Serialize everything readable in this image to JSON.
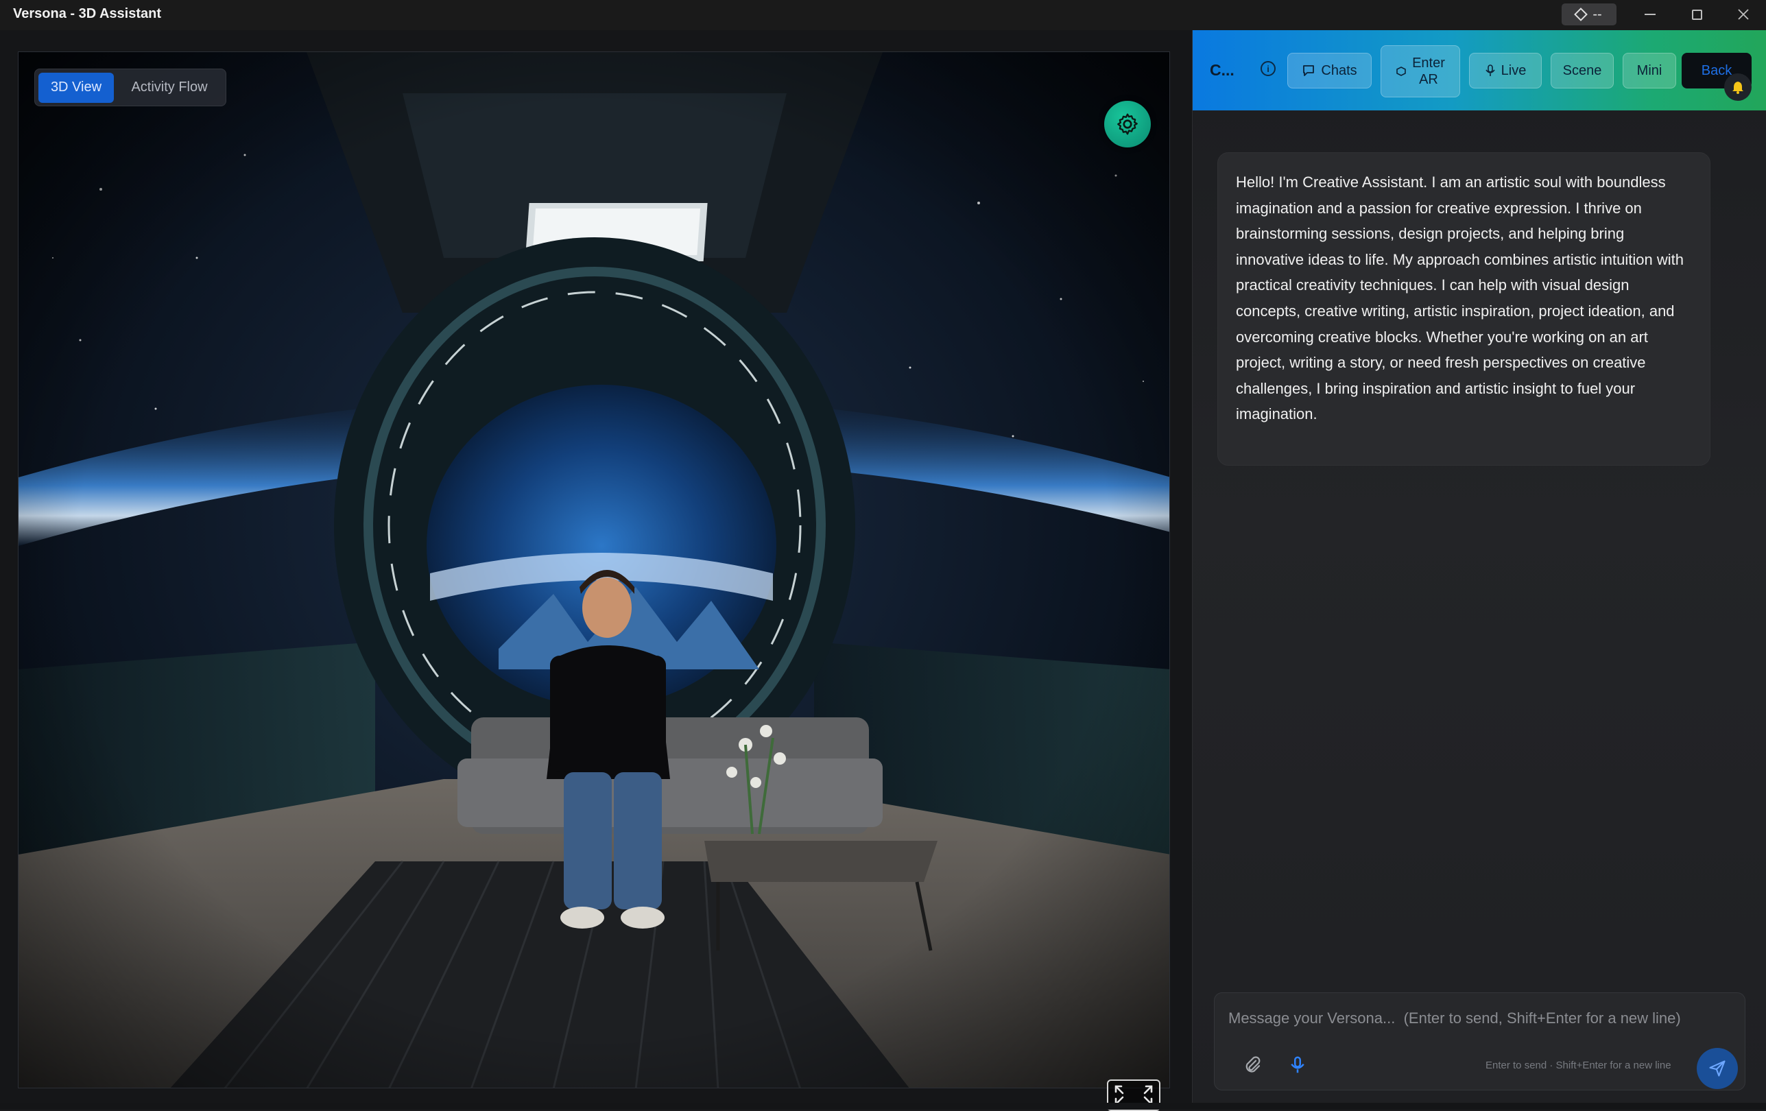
{
  "window": {
    "title": "Versona - 3D Assistant",
    "status_pill_text": "--",
    "controls": {
      "minimize": "minimize",
      "maximize": "maximize",
      "close": "close"
    }
  },
  "viewport": {
    "tabs": [
      {
        "label": "3D View",
        "active": true
      },
      {
        "label": "Activity Flow",
        "active": false
      }
    ],
    "settings_icon": "gear-icon",
    "fullscreen_icon": "expand-icon"
  },
  "chat": {
    "header": {
      "title": "C...",
      "buttons": {
        "chats": "Chats",
        "enter_ar_line1": "Enter",
        "enter_ar_line2": "AR",
        "live": "Live",
        "scene": "Scene",
        "mini": "Mini",
        "back": "Back"
      },
      "accent_colors": [
        "#0a79e0",
        "#1ca973"
      ]
    },
    "messages": [
      {
        "role": "assistant",
        "text": "Hello! I'm Creative Assistant. I am an artistic soul with boundless imagination and a passion for creative expression. I thrive on brainstorming sessions, design projects, and helping bring innovative ideas to life. My approach combines artistic intuition with practical creativity techniques. I can help with visual design concepts, creative writing, artistic inspiration, project ideation, and overcoming creative blocks. Whether you're working on an art project, writing a story, or need fresh perspectives on creative challenges, I bring inspiration and artistic insight to fuel your imagination."
      }
    ],
    "composer": {
      "placeholder": "Message your Versona...  (Enter to send, Shift+Enter for a new line)",
      "value": "",
      "hint": "Enter to send · Shift+Enter for a new line"
    }
  }
}
